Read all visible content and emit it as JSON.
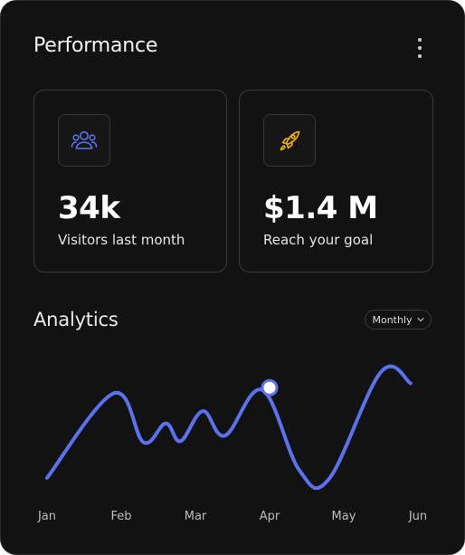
{
  "header": {
    "title": "Performance"
  },
  "stats": [
    {
      "value": "34k",
      "label": "Visitors last month",
      "icon": "users-icon",
      "icon_color": "#5b72f0"
    },
    {
      "value": "$1.4 M",
      "label": "Reach your goal",
      "icon": "rocket-icon",
      "icon_color": "#f4b400"
    }
  ],
  "analytics": {
    "title": "Analytics",
    "period_label": "Monthly",
    "line_color": "#5b72f0"
  },
  "chart_data": {
    "type": "line",
    "x_categories": [
      "Jan",
      "Feb",
      "Mar",
      "Apr",
      "May",
      "Jun"
    ],
    "series": [
      {
        "points": [
          [
            0.0,
            0.05
          ],
          [
            0.9,
            0.81
          ],
          [
            1.3,
            0.37
          ],
          [
            1.6,
            0.54
          ],
          [
            1.8,
            0.38
          ],
          [
            2.1,
            0.65
          ],
          [
            2.4,
            0.43
          ],
          [
            2.9,
            0.84
          ],
          [
            3.4,
            0.12
          ],
          [
            3.8,
            0.04
          ],
          [
            4.5,
            1.0
          ],
          [
            4.9,
            0.9
          ]
        ]
      }
    ],
    "highlight": {
      "x": 3.0,
      "y": 0.86
    },
    "grid": false,
    "legend": "none"
  }
}
